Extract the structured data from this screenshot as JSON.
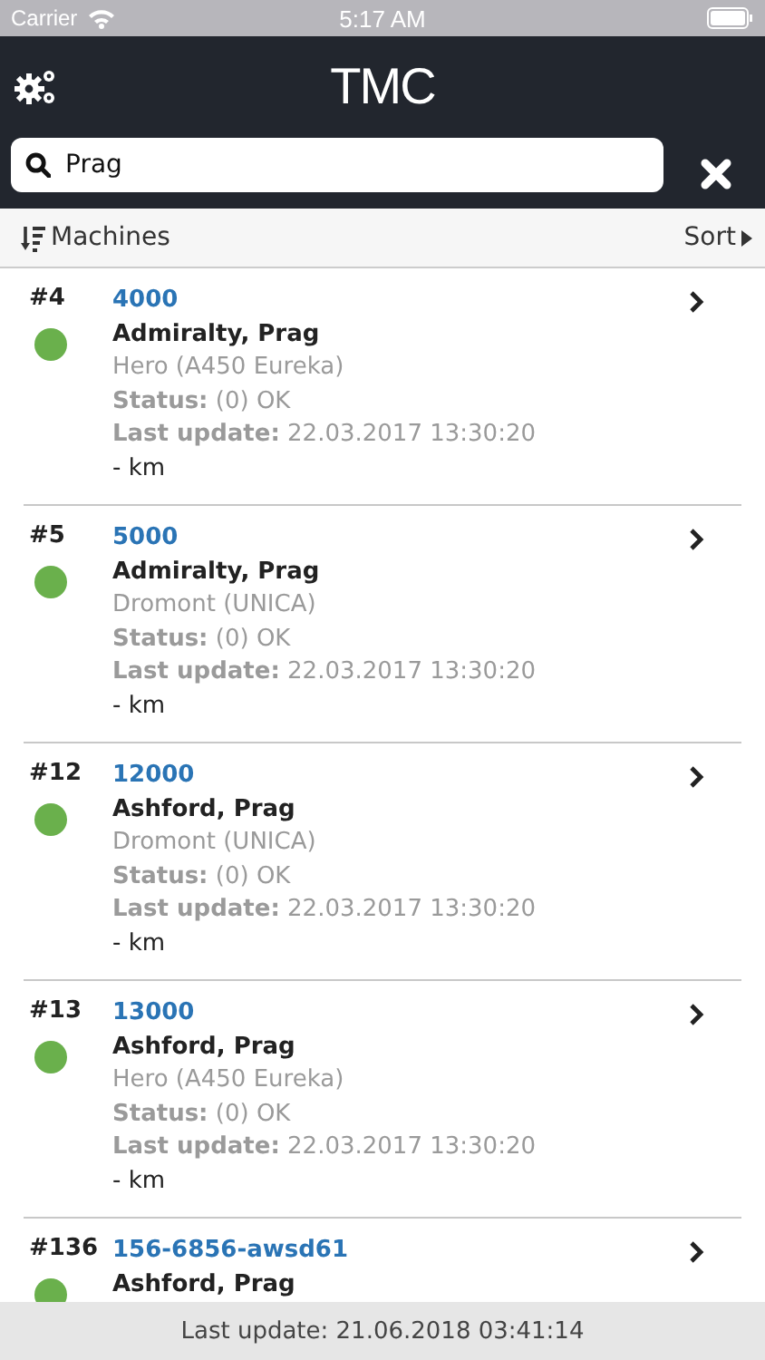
{
  "status_bar": {
    "carrier": "Carrier",
    "time": "5:17 AM"
  },
  "header": {
    "logo": "TMC"
  },
  "search": {
    "value": "Prag"
  },
  "toolbar": {
    "title": "Machines",
    "sort": "Sort"
  },
  "machines": [
    {
      "number": "#4",
      "id": "4000",
      "location": "Admiralty, Prag",
      "model": "Hero (A450 Eureka)",
      "status": "**Status:** (0) OK",
      "updated": "**Last update:** 22.03.2017 13:30:20",
      "distance": "- km",
      "color": "#6ab04c"
    },
    {
      "number": "#5",
      "id": "5000",
      "location": "Admiralty, Prag",
      "model": "Dromont (UNICA)",
      "status": "**Status:** (0) OK",
      "updated": "**Last update:** 22.03.2017 13:30:20",
      "distance": "- km",
      "color": "#6ab04c"
    },
    {
      "number": "#12",
      "id": "12000",
      "location": "Ashford, Prag",
      "model": "Dromont (UNICA)",
      "status": "**Status:** (0) OK",
      "updated": "**Last update:** 22.03.2017 13:30:20",
      "distance": "- km",
      "color": "#6ab04c"
    },
    {
      "number": "#13",
      "id": "13000",
      "location": "Ashford, Prag",
      "model": "Hero (A450 Eureka)",
      "status": "**Status:** (0) OK",
      "updated": "**Last update:** 22.03.2017 13:30:20",
      "distance": "- km",
      "color": "#6ab04c"
    },
    {
      "number": "#136",
      "id": "156-6856-awsd61",
      "location": "Ashford, Prag",
      "color": "#6ab04c"
    }
  ],
  "footer": {
    "text": "Last update: 21.06.2018 03:41:14"
  }
}
